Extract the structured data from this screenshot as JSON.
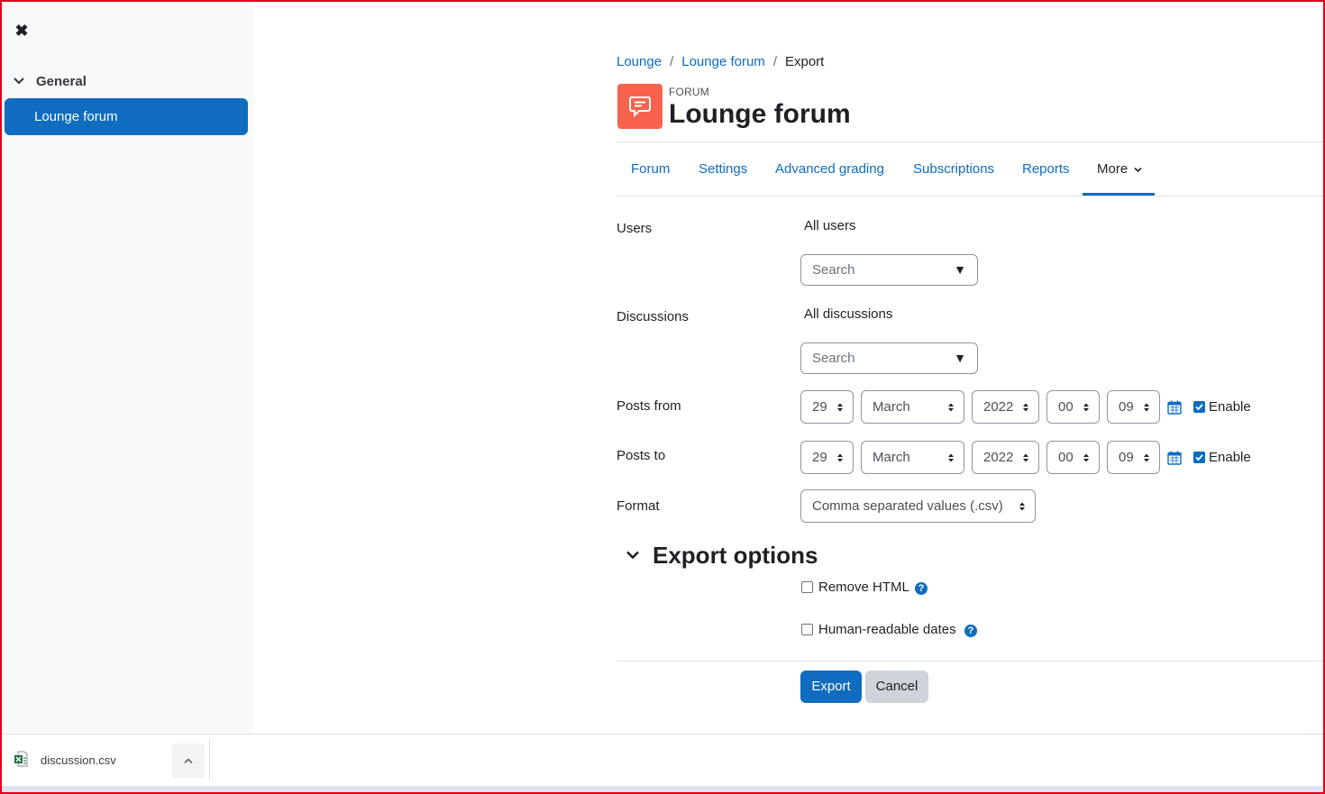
{
  "drawer": {
    "section": "General",
    "active_item": "Lounge forum"
  },
  "breadcrumb": [
    "Lounge",
    "Lounge forum",
    "Export"
  ],
  "header": {
    "module_type": "FORUM",
    "title": "Lounge forum",
    "icon_color": "#f7634d"
  },
  "tabs": [
    {
      "label": "Forum"
    },
    {
      "label": "Settings"
    },
    {
      "label": "Advanced grading"
    },
    {
      "label": "Subscriptions"
    },
    {
      "label": "Reports"
    },
    {
      "label": "More"
    }
  ],
  "form": {
    "users": {
      "label": "Users",
      "value": "All users",
      "search_placeholder": "Search"
    },
    "discussions": {
      "label": "Discussions",
      "value": "All discussions",
      "search_placeholder": "Search"
    },
    "posts_from": {
      "label": "Posts from",
      "day": "29",
      "month": "March",
      "year": "2022",
      "hour": "00",
      "minute": "09",
      "enable_label": "Enable",
      "enabled": true
    },
    "posts_to": {
      "label": "Posts to",
      "day": "29",
      "month": "March",
      "year": "2022",
      "hour": "00",
      "minute": "09",
      "enable_label": "Enable",
      "enabled": true
    },
    "format": {
      "label": "Format",
      "value": "Comma separated values (.csv)"
    }
  },
  "export_options": {
    "heading": "Export options",
    "remove_html": "Remove HTML",
    "human_readable_dates": "Human-readable dates"
  },
  "buttons": {
    "export": "Export",
    "cancel": "Cancel"
  },
  "download_bar": {
    "filename": "discussion.csv"
  },
  "colors": {
    "primary": "#0f6cbf",
    "forum_icon": "#f7634d",
    "frame": "#e0001b"
  }
}
